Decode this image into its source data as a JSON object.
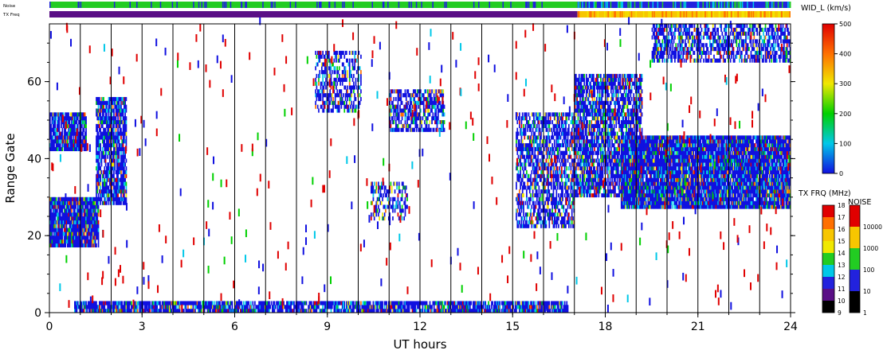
{
  "chart_data": {
    "type": "heatmap",
    "title": "",
    "xlabel": "UT hours",
    "ylabel": "Range Gate",
    "xlim": [
      0,
      24
    ],
    "ylim": [
      0,
      75
    ],
    "xticks": [
      "0",
      "3",
      "6",
      "9",
      "12",
      "15",
      "18",
      "21",
      "24"
    ],
    "yticks": [
      "0",
      "20",
      "40",
      "60"
    ],
    "vertical_lines_every_hours": 1,
    "top_bars": {
      "noise_label": "Noise",
      "txfreq_label": "TX Freq",
      "noise_segments": [
        {
          "start": 0.0,
          "end": 17.1,
          "color": "#22cc22"
        },
        {
          "start": 17.1,
          "end": 24.0,
          "color": "#2222dd"
        }
      ],
      "txfreq_segments": [
        {
          "start": 0.0,
          "end": 17.1,
          "color": "#5a0f86"
        },
        {
          "start": 17.1,
          "end": 24.0,
          "color": "#f7c600"
        }
      ]
    },
    "colorbars": {
      "width": {
        "label": "WID_L (km/s)",
        "ticks": [
          "0",
          "100",
          "200",
          "300",
          "400",
          "500"
        ],
        "range": [
          0,
          500
        ],
        "colors": [
          "#1010e0",
          "#00c8e8",
          "#00d000",
          "#f0e800",
          "#ff7000",
          "#e00000"
        ]
      },
      "txfreq": {
        "label": "TX FRQ (MHz)",
        "ticks": [
          "9",
          "10",
          "11",
          "12",
          "13",
          "14",
          "15",
          "16",
          "17",
          "18"
        ],
        "colors": [
          "#000000",
          "#5a0f86",
          "#2222dd",
          "#00c8e8",
          "#22cc22",
          "#f0e800",
          "#f7c600",
          "#ff7000",
          "#e00000"
        ]
      },
      "noise": {
        "label": "NOISE",
        "ticks": [
          "1",
          "10",
          "100",
          "1000",
          "10000"
        ],
        "colors": [
          "#000000",
          "#2222dd",
          "#22cc22",
          "#f7c600",
          "#e00000"
        ]
      }
    },
    "echo_regions": [
      {
        "name": "ground scatter band",
        "x": [
          0.8,
          16.8
        ],
        "y": [
          0,
          3
        ],
        "density": 0.85
      },
      {
        "name": "early blob",
        "x": [
          0.0,
          1.6
        ],
        "y": [
          17,
          30
        ],
        "density": 0.95
      },
      {
        "name": "early upper",
        "x": [
          0.0,
          1.2
        ],
        "y": [
          42,
          52
        ],
        "density": 0.9
      },
      {
        "name": "rising arc",
        "x": [
          1.5,
          2.5
        ],
        "y": [
          28,
          56
        ],
        "density": 0.8
      },
      {
        "name": "cluster 9h",
        "x": [
          8.6,
          10.1
        ],
        "y": [
          52,
          68
        ],
        "density": 0.5
      },
      {
        "name": "cluster 12h",
        "x": [
          11.0,
          12.8
        ],
        "y": [
          47,
          58
        ],
        "density": 0.6
      },
      {
        "name": "cluster 11h",
        "x": [
          10.4,
          11.6
        ],
        "y": [
          24,
          34
        ],
        "density": 0.4
      },
      {
        "name": "afternoon patch",
        "x": [
          15.1,
          17.0
        ],
        "y": [
          22,
          52
        ],
        "density": 0.6
      },
      {
        "name": "evening rise",
        "x": [
          17.0,
          19.2
        ],
        "y": [
          30,
          62
        ],
        "density": 0.75
      },
      {
        "name": "night band",
        "x": [
          18.5,
          24.0
        ],
        "y": [
          27,
          46
        ],
        "density": 0.95
      },
      {
        "name": "top patches",
        "x": [
          19.5,
          24.0
        ],
        "y": [
          65,
          75
        ],
        "density": 0.6
      }
    ]
  }
}
